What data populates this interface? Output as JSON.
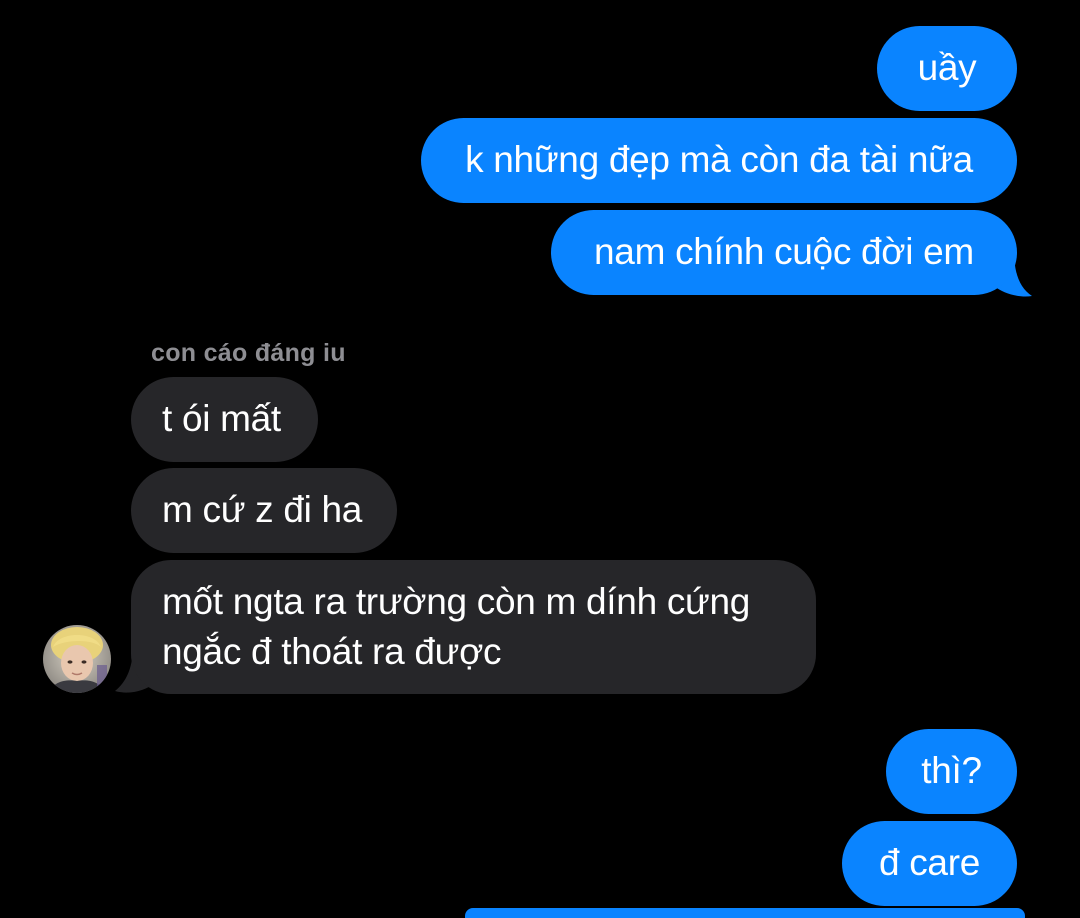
{
  "conversation": {
    "sender_name": "con cáo đáng iu",
    "messages": [
      {
        "direction": "sent",
        "text": "uầy"
      },
      {
        "direction": "sent",
        "text": "k những đẹp mà còn đa tài nữa"
      },
      {
        "direction": "sent",
        "text": "nam chính cuộc đời em"
      },
      {
        "direction": "received",
        "text": "t ói mất"
      },
      {
        "direction": "received",
        "text": "m cứ z đi ha"
      },
      {
        "direction": "received",
        "lines": [
          "mốt ngta ra trường còn m dính cứng",
          "ngắc đ thoát ra được"
        ]
      },
      {
        "direction": "sent",
        "text": "thì?"
      },
      {
        "direction": "sent",
        "text": "đ care"
      }
    ]
  },
  "colors": {
    "background": "#000000",
    "sent_bubble": "#0a84ff",
    "received_bubble": "#262629",
    "sender_name": "#8e8e93",
    "text": "#ffffff"
  },
  "icons": {
    "avatar": "contact-photo"
  }
}
